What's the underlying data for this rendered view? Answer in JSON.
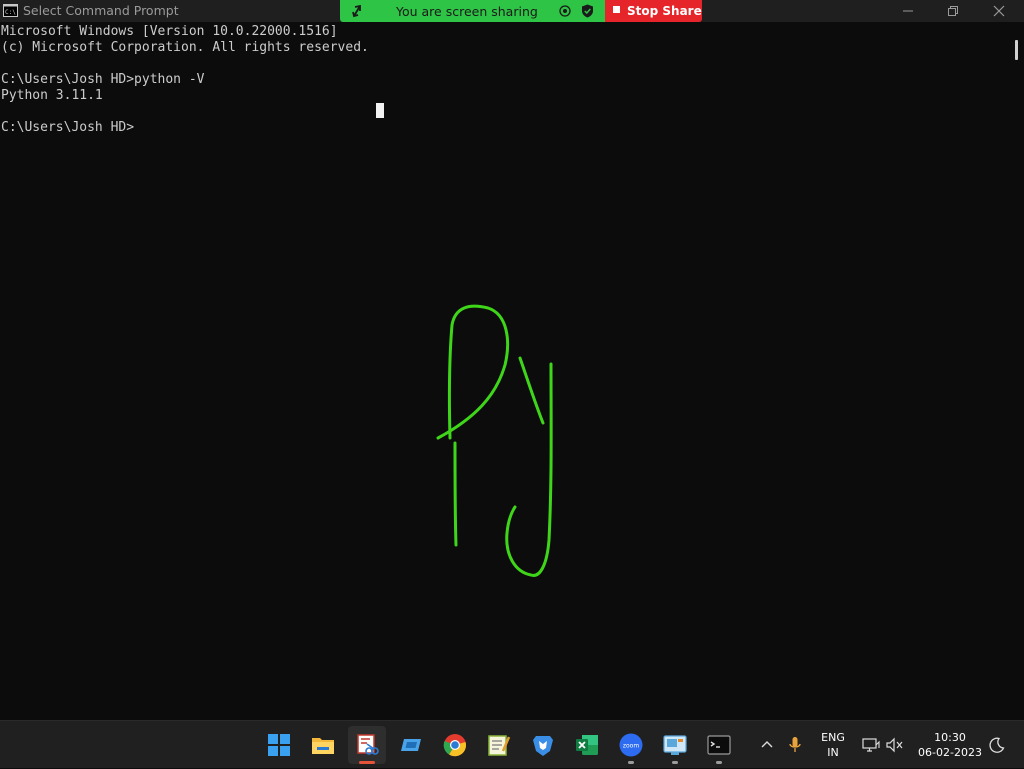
{
  "window": {
    "title": "Select Command Prompt",
    "icon": "cmd-icon"
  },
  "screen_share": {
    "status_text": "You are screen sharing",
    "stop_label": "Stop Share",
    "colors": {
      "share_bar": "#2ec445",
      "stop_button": "#e5252a"
    }
  },
  "console": {
    "lines": [
      "Microsoft Windows [Version 10.0.22000.1516]",
      "(c) Microsoft Corporation. All rights reserved.",
      "",
      "C:\\Users\\Josh HD>python -V",
      "Python 3.11.1",
      "",
      "C:\\Users\\Josh HD>"
    ],
    "colors": {
      "background": "#0c0c0c",
      "text": "#cccccc",
      "drawing": "#3fd61a"
    }
  },
  "taskbar": {
    "apps": [
      {
        "name": "start-button",
        "icon": "windows-logo-icon"
      },
      {
        "name": "file-explorer",
        "icon": "folder-icon"
      },
      {
        "name": "snipping-tool",
        "icon": "snipping-tool-icon",
        "active": true
      },
      {
        "name": "app-blue",
        "icon": "blue-app-icon"
      },
      {
        "name": "chrome",
        "icon": "chrome-icon"
      },
      {
        "name": "notepad",
        "icon": "notepad-icon"
      },
      {
        "name": "brave",
        "icon": "brave-icon"
      },
      {
        "name": "excel",
        "icon": "excel-icon"
      },
      {
        "name": "zoom",
        "icon": "zoom-icon",
        "label": "zoom"
      },
      {
        "name": "remote-desktop",
        "icon": "remote-desktop-icon"
      },
      {
        "name": "command-prompt",
        "icon": "terminal-icon"
      }
    ],
    "tray": {
      "language_line1": "ENG",
      "language_line2": "IN",
      "time": "10:30",
      "date": "06-02-2023"
    }
  }
}
